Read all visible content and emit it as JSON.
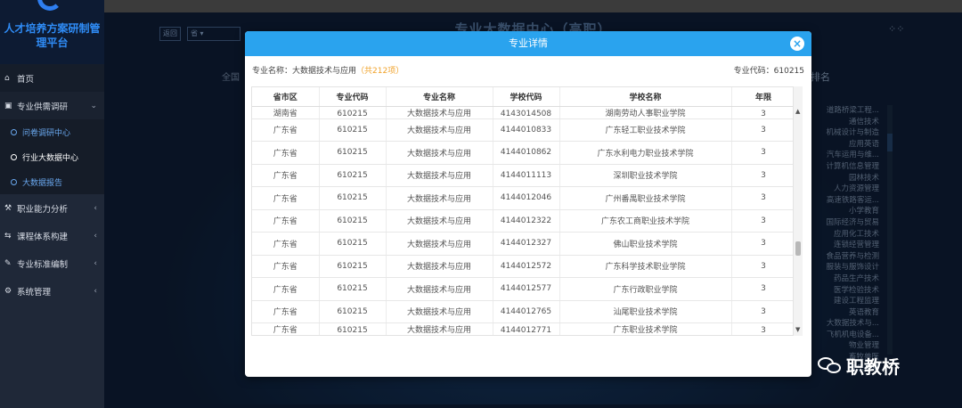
{
  "app": {
    "brand": "人才培养方案研制管理平台"
  },
  "sidebar": {
    "items": [
      {
        "label": "首页",
        "icon": "home-icon"
      },
      {
        "label": "专业供需调研",
        "icon": "survey-icon"
      },
      {
        "label": "职业能力分析",
        "icon": "ability-icon"
      },
      {
        "label": "课程体系构建",
        "icon": "course-icon"
      },
      {
        "label": "专业标准编制",
        "icon": "standard-icon"
      },
      {
        "label": "系统管理",
        "icon": "settings-icon"
      }
    ],
    "sub_items": [
      {
        "label": "问卷调研中心"
      },
      {
        "label": "行业大数据中心"
      },
      {
        "label": "大数据报告"
      }
    ]
  },
  "dashboard": {
    "title": "专业大数据中心（高职）",
    "back_label": "返回",
    "province_select": "省 ▾",
    "nation_label": "全国",
    "rank_title": "排名",
    "rank_items": [
      "道路桥梁工程...",
      "通信技术",
      "机械设计与制造",
      "应用英语",
      "汽车运用与维...",
      "计算机信息管理",
      "园林技术",
      "人力资源管理",
      "高速铁路客运...",
      "小学教育",
      "国际经济与贸易",
      "应用化工技术",
      "连锁经营管理",
      "食品营养与检测",
      "服装与服饰设计",
      "药品生产技术",
      "医学检验技术",
      "建设工程监理",
      "英语教育",
      "大数据技术与...",
      "飞机机电设备...",
      "物业管理",
      "畜牧兽医",
      "音乐表演"
    ]
  },
  "modal": {
    "title": "专业详情",
    "major_label": "专业名称：",
    "major_name": "大数据技术与应用",
    "count_text": "（共212项）",
    "code_label": "专业代码：",
    "code_value": "610215",
    "columns": [
      "省市区",
      "专业代码",
      "专业名称",
      "学校代码",
      "学校名称",
      "年限"
    ],
    "rows": [
      [
        "湖南省",
        "610215",
        "大数据技术与应用",
        "4143014508",
        "湖南劳动人事职业学院",
        "3"
      ],
      [
        "广东省",
        "610215",
        "大数据技术与应用",
        "4144010833",
        "广东轻工职业技术学院",
        "3"
      ],
      [
        "广东省",
        "610215",
        "大数据技术与应用",
        "4144010862",
        "广东水利电力职业技术学院",
        "3"
      ],
      [
        "广东省",
        "610215",
        "大数据技术与应用",
        "4144011113",
        "深圳职业技术学院",
        "3"
      ],
      [
        "广东省",
        "610215",
        "大数据技术与应用",
        "4144012046",
        "广州番禺职业技术学院",
        "3"
      ],
      [
        "广东省",
        "610215",
        "大数据技术与应用",
        "4144012322",
        "广东农工商职业技术学院",
        "3"
      ],
      [
        "广东省",
        "610215",
        "大数据技术与应用",
        "4144012327",
        "佛山职业技术学院",
        "3"
      ],
      [
        "广东省",
        "610215",
        "大数据技术与应用",
        "4144012572",
        "广东科学技术职业学院",
        "3"
      ],
      [
        "广东省",
        "610215",
        "大数据技术与应用",
        "4144012577",
        "广东行政职业学院",
        "3"
      ],
      [
        "广东省",
        "610215",
        "大数据技术与应用",
        "4144012765",
        "汕尾职业技术学院",
        "3"
      ],
      [
        "广东省",
        "610215",
        "大数据技术与应用",
        "4144012771",
        "广东职业技术学院",
        "3"
      ]
    ]
  },
  "watermark": {
    "text": "职教桥"
  }
}
